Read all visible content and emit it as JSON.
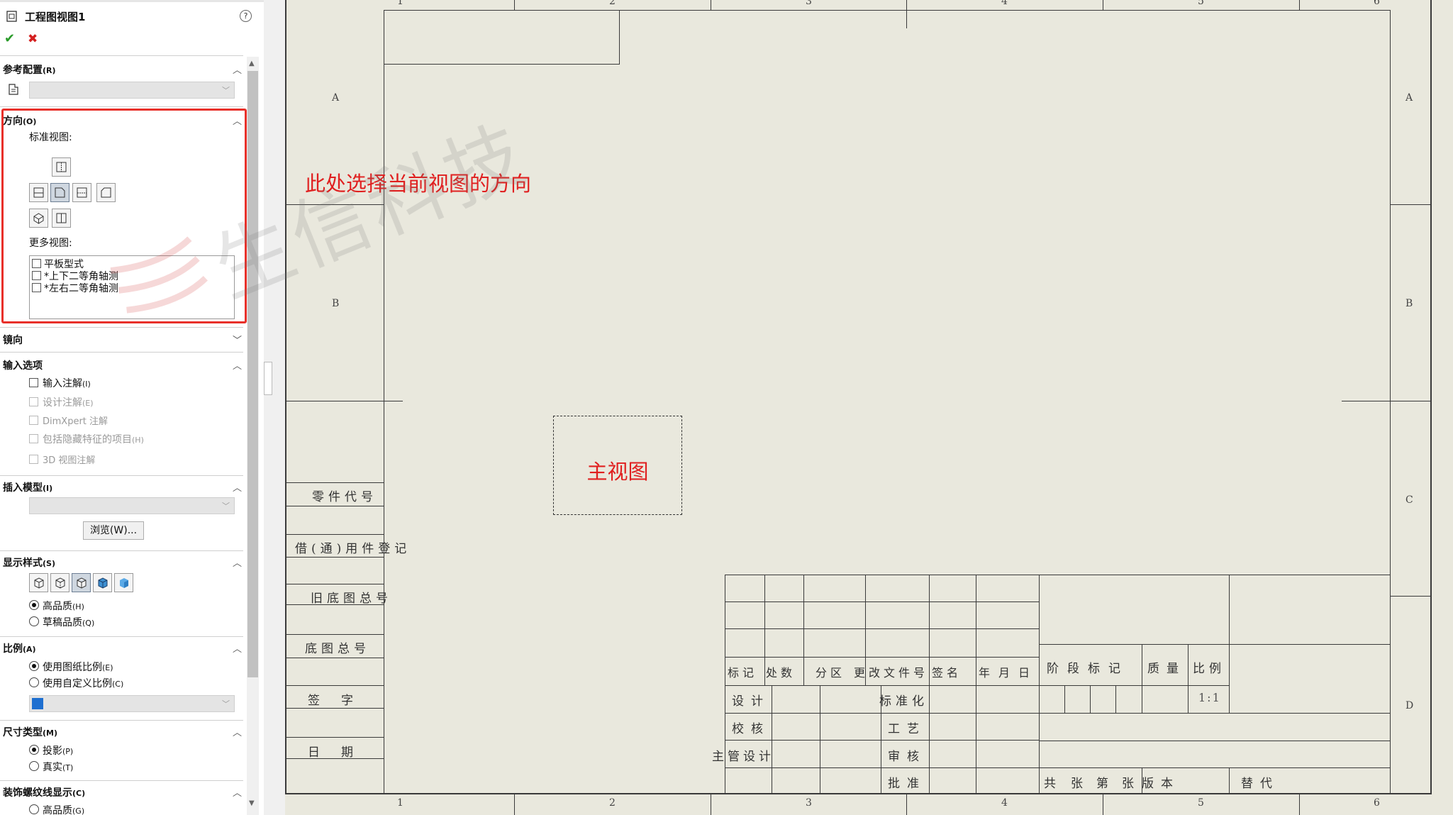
{
  "panel": {
    "title": "工程图视图1",
    "help_label": "?",
    "ok_label": "✔",
    "cancel_label": "✖",
    "sections": {
      "ref_config": {
        "title": "参考配置",
        "key": "(R)"
      },
      "orientation": {
        "title": "方向",
        "key": "(O)",
        "standard_views_label": "标准视图:",
        "more_views_label": "更多视图:",
        "more_views": [
          "平板型式",
          "*上下二等角轴测",
          "*左右二等角轴测"
        ]
      },
      "mirror": {
        "title": "镜向"
      },
      "import": {
        "title": "输入选项",
        "options": [
          {
            "label": "输入注解",
            "key": "(I)",
            "enabled": true
          },
          {
            "label": "设计注解",
            "key": "(E)",
            "enabled": false
          },
          {
            "label": "DimXpert 注解",
            "key": "",
            "enabled": false
          },
          {
            "label": "包括隐藏特征的项目",
            "key": "(H)",
            "enabled": false
          },
          {
            "label": "3D 视图注解",
            "key": "",
            "enabled": false
          }
        ]
      },
      "insert_model": {
        "title": "插入模型",
        "key": "(I)",
        "browse_label": "浏览(W)..."
      },
      "display_style": {
        "title": "显示样式",
        "key": "(S)",
        "options": [
          {
            "label": "高品质",
            "key": "(H)",
            "selected": true
          },
          {
            "label": "草稿品质",
            "key": "(Q)",
            "selected": false
          }
        ]
      },
      "scale": {
        "title": "比例",
        "key": "(A)",
        "options": [
          {
            "label": "使用图纸比例",
            "key": "(E)",
            "selected": true
          },
          {
            "label": "使用自定义比例",
            "key": "(C)",
            "selected": false
          }
        ]
      },
      "dim_type": {
        "title": "尺寸类型",
        "key": "(M)",
        "options": [
          {
            "label": "投影",
            "key": "(P)",
            "selected": true
          },
          {
            "label": "真实",
            "key": "(T)",
            "selected": false
          }
        ]
      },
      "thread": {
        "title": "装饰螺纹线显示",
        "key": "(C)",
        "first_option": "高品质",
        "first_key": "(G)"
      }
    }
  },
  "annotations": {
    "orientation_hint": "此处选择当前视图的方向",
    "main_view": "主视图",
    "watermark": "生信科技"
  },
  "sheet": {
    "zones_cols": [
      "1",
      "2",
      "3",
      "4",
      "5",
      "6"
    ],
    "zones_rows": [
      "A",
      "B",
      "C",
      "D"
    ],
    "left_strip": [
      "零件代号",
      "借(通)用件登记",
      "旧底图总号",
      "底图总号",
      "签字",
      "日期"
    ],
    "title_block": {
      "header": [
        "标记",
        "处数",
        "分区",
        "更改文件号",
        "签名",
        "年月日"
      ],
      "rows": [
        "设计",
        "校核",
        "主管设计"
      ],
      "mid": [
        "标准化",
        "工艺",
        "审核",
        "批准"
      ],
      "stage_header": [
        "阶段标记",
        "质量",
        "比例"
      ],
      "scale_value": "1:1",
      "footer": [
        "共",
        "张",
        "第",
        "张",
        "版本",
        "替代"
      ]
    }
  },
  "colors": {
    "sheet": "#e9e8dd",
    "accent": "#e02020",
    "line": "#3a3a3a"
  }
}
